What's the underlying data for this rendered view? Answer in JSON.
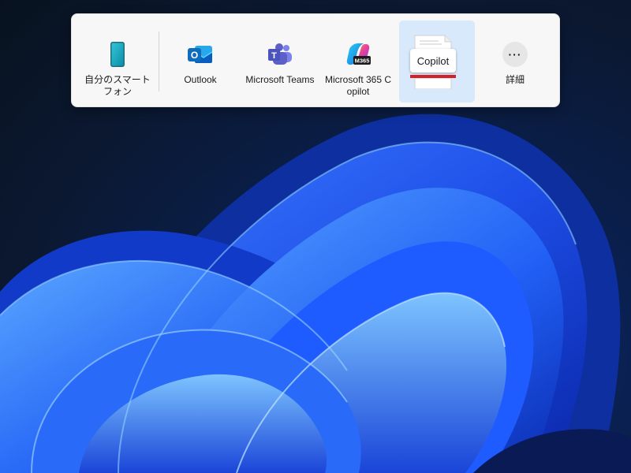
{
  "share_panel": {
    "items": [
      {
        "label": "自分のスマートフォン",
        "icon": "phone-icon"
      },
      {
        "label": "Outlook",
        "icon": "outlook-icon"
      },
      {
        "label": "Microsoft Teams",
        "icon": "teams-icon"
      },
      {
        "label": "Microsoft 365 Copilot",
        "icon": "m365-copilot-icon",
        "badge": "M365"
      },
      {
        "label": "Copilot",
        "icon": "copilot-document-icon",
        "selected": true
      },
      {
        "label": "詳細",
        "icon": "more-icon",
        "glyph": "···"
      }
    ]
  },
  "colors": {
    "panel_bg": "#f7f7f7",
    "selected_bg": "#d7e9fb",
    "copilot_stripe": "#d32029",
    "wallpaper_blue": "#1f5cff"
  }
}
